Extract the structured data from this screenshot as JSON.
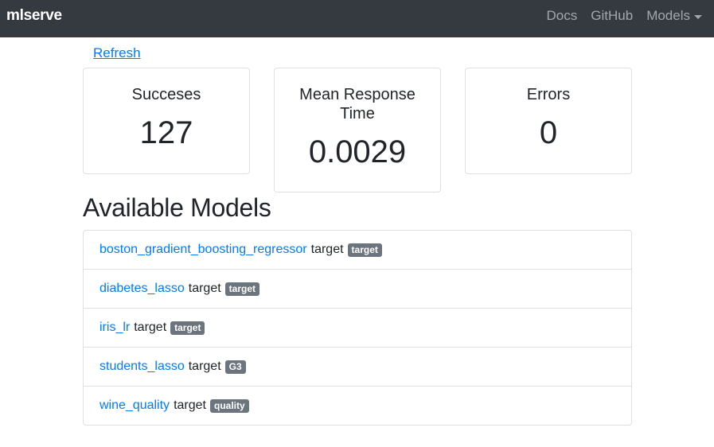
{
  "navbar": {
    "brand": "mlserve",
    "links": [
      "Docs",
      "GitHub",
      "Models"
    ]
  },
  "refresh_label": "Refresh",
  "stats": {
    "successes": {
      "title": "Succeses",
      "value": "127"
    },
    "mean_response": {
      "title": "Mean Response Time",
      "value": "0.0029"
    },
    "errors": {
      "title": "Errors",
      "value": "0"
    }
  },
  "section_title": "Available Models",
  "models": [
    {
      "name": "boston_gradient_boosting_regressor",
      "target_label": "target",
      "badge": "target"
    },
    {
      "name": "diabetes_lasso",
      "target_label": "target",
      "badge": "target"
    },
    {
      "name": "iris_lr",
      "target_label": "target",
      "badge": "target"
    },
    {
      "name": "students_lasso",
      "target_label": "target",
      "badge": "G3"
    },
    {
      "name": "wine_quality",
      "target_label": "target",
      "badge": "quality"
    }
  ],
  "colors": {
    "navbar_bg": "#343a40",
    "link": "#007bff",
    "badge_bg": "#6c757d"
  }
}
